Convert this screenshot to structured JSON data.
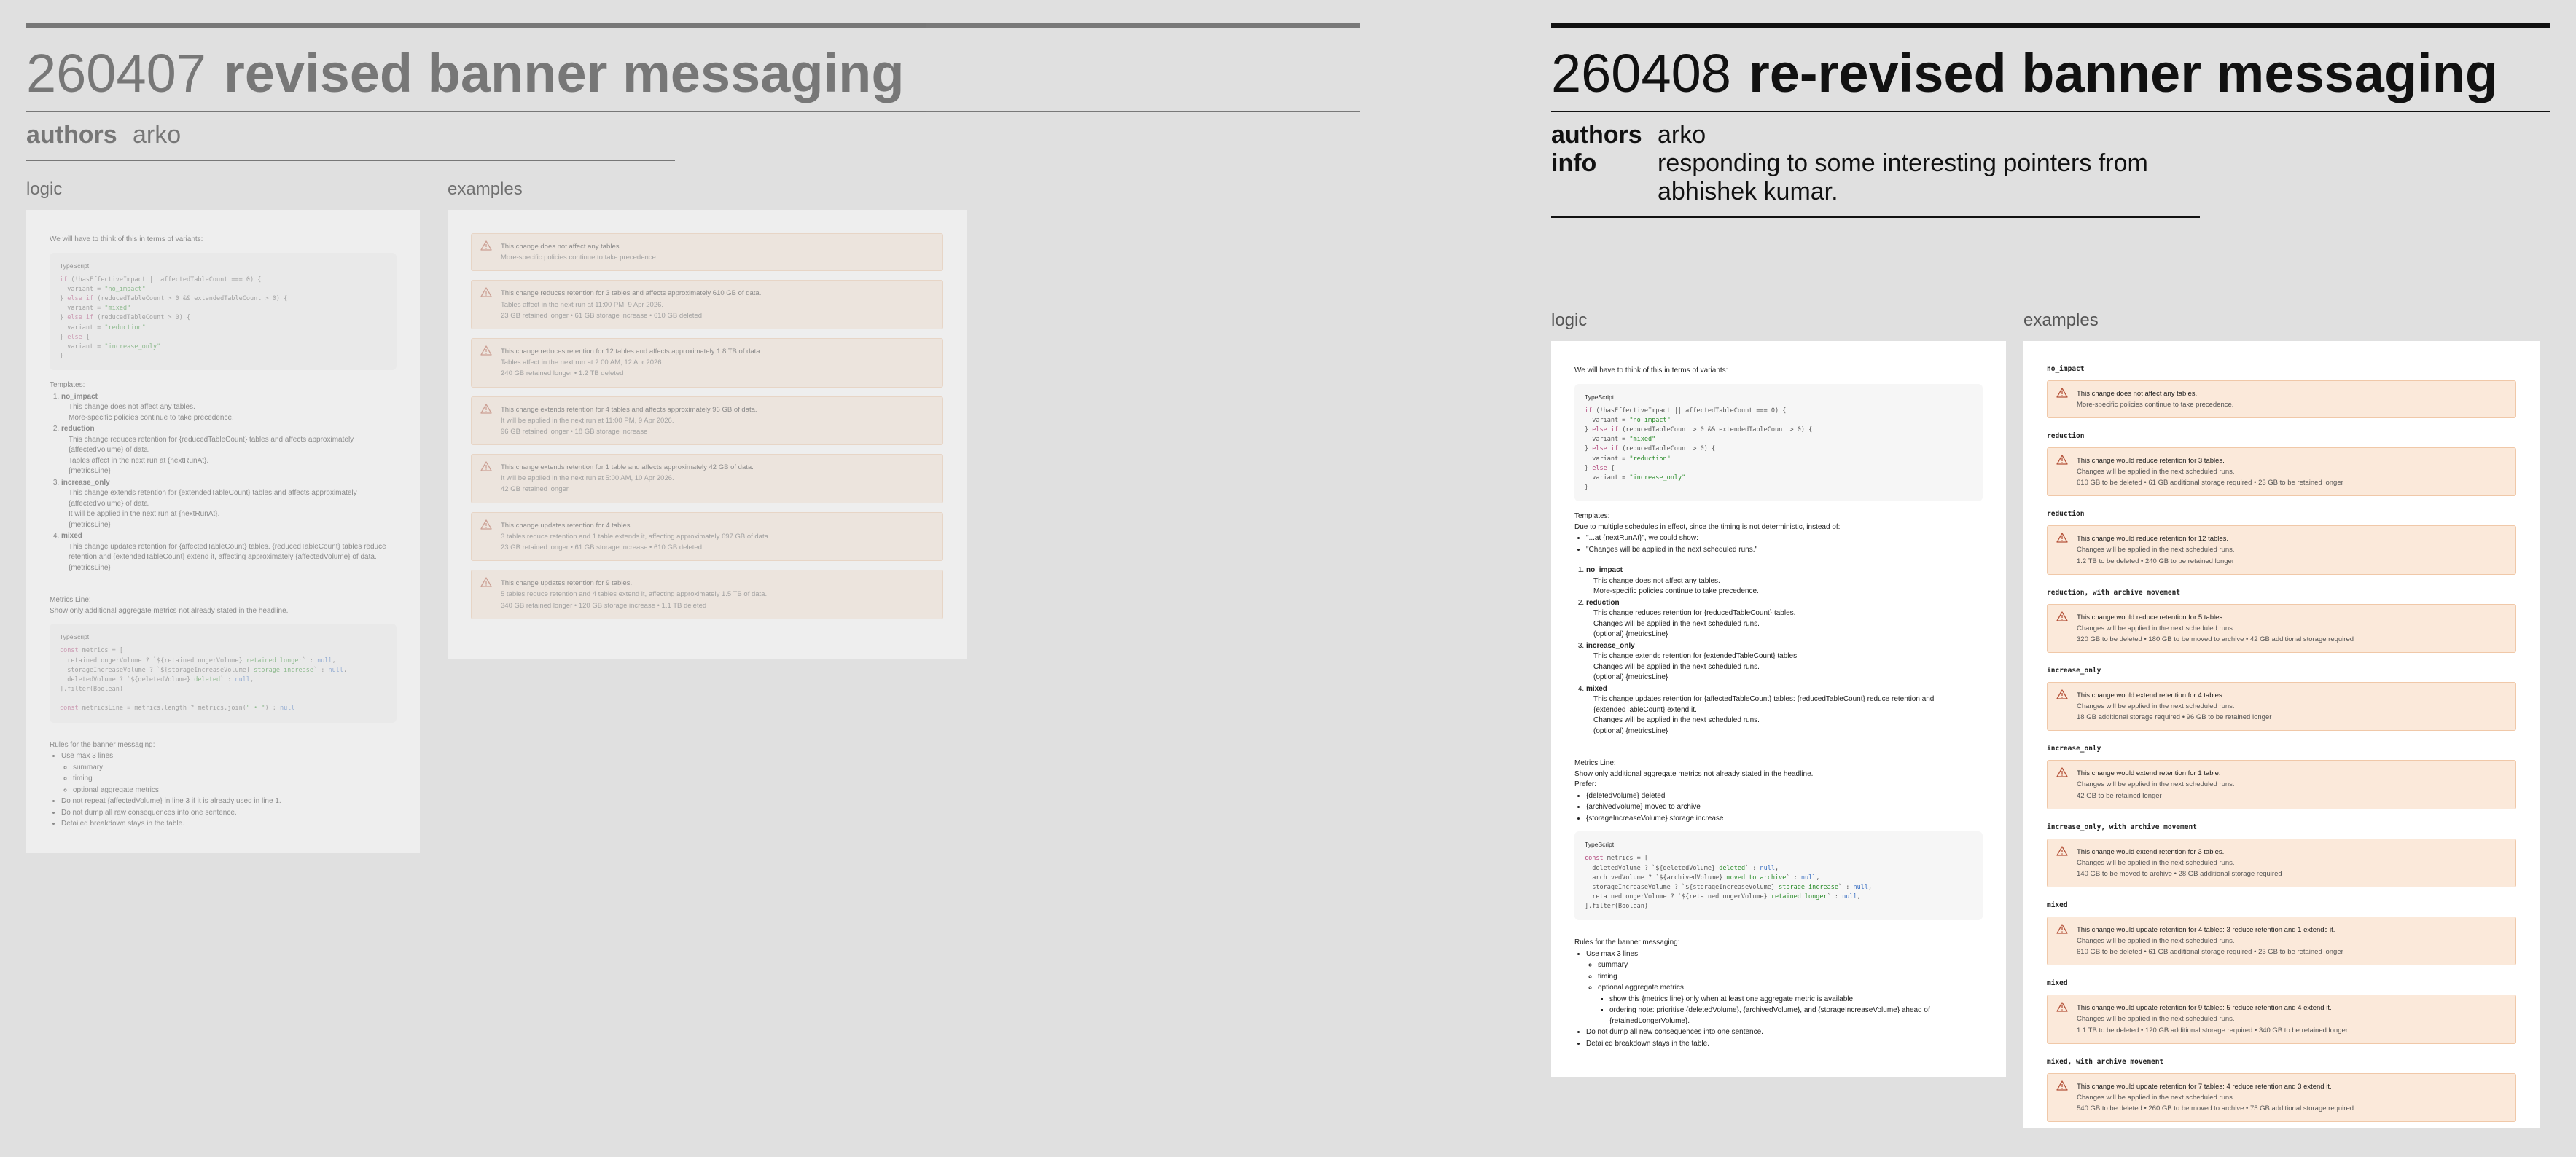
{
  "left": {
    "number": "260407",
    "name": "revised banner messaging",
    "meta": [
      {
        "k": "authors",
        "v": "arko"
      }
    ],
    "logic_label": "logic",
    "examples_label": "examples",
    "intro": "We will have to think of this in terms of variants:",
    "code_lang": "TypeScript",
    "templates_label": "Templates:",
    "templates": [
      {
        "name": "no_impact",
        "lines": [
          "This change does not affect any tables.",
          "More-specific policies continue to take precedence."
        ]
      },
      {
        "name": "reduction",
        "lines": [
          "This change reduces retention for {reducedTableCount} tables and affects approximately {affectedVolume} of data.",
          "Tables affect in the next run at {nextRunAt}.",
          "{metricsLine}"
        ]
      },
      {
        "name": "increase_only",
        "lines": [
          "This change extends retention for {extendedTableCount} tables and affects approximately {affectedVolume} of data.",
          "It will be applied in the next run at {nextRunAt}.",
          "{metricsLine}"
        ]
      },
      {
        "name": "mixed",
        "lines": [
          "This change updates retention for {affectedTableCount} tables. {reducedTableCount} tables reduce retention and {extendedTableCount} extend it, affecting approximately {affectedVolume} of data.",
          "{metricsLine}"
        ]
      }
    ],
    "metrics_label": "Metrics Line:",
    "metrics_desc": "Show only additional aggregate metrics not already stated in the headline.",
    "rules_label": "Rules for the banner messaging:",
    "rules": [
      "Use max 3 lines:",
      "summary",
      "timing",
      "optional aggregate metrics",
      "Do not repeat {affectedVolume} in line 3 if it is already used in line 1.",
      "Do not dump all raw consequences into one sentence.",
      "Detailed breakdown stays in the table."
    ],
    "examples": [
      {
        "h": "This change does not affect any tables.",
        "s": [
          "More-specific policies continue to take precedence."
        ]
      },
      {
        "h": "This change reduces retention for 3 tables and affects approximately 610 GB of data.",
        "s": [
          "Tables affect in the next run at 11:00 PM, 9 Apr 2026.",
          "23 GB retained longer • 61 GB storage increase • 610 GB deleted"
        ]
      },
      {
        "h": "This change reduces retention for 12 tables and affects approximately 1.8 TB of data.",
        "s": [
          "Tables affect in the next run at 2:00 AM, 12 Apr 2026.",
          "240 GB retained longer • 1.2 TB deleted"
        ]
      },
      {
        "h": "This change extends retention for 4 tables and affects approximately 96 GB of data.",
        "s": [
          "It will be applied in the next run at 11:00 PM, 9 Apr 2026.",
          "96 GB retained longer • 18 GB storage increase"
        ]
      },
      {
        "h": "This change extends retention for 1 table and affects approximately 42 GB of data.",
        "s": [
          "It will be applied in the next run at 5:00 AM, 10 Apr 2026.",
          "42 GB retained longer"
        ]
      },
      {
        "h": "This change updates retention for 4 tables.",
        "s": [
          "3 tables reduce retention and 1 table extends it, affecting approximately 697 GB of data.",
          "23 GB retained longer • 61 GB storage increase • 610 GB deleted"
        ]
      },
      {
        "h": "This change updates retention for 9 tables.",
        "s": [
          "5 tables reduce retention and 4 tables extend it, affecting approximately 1.5 TB of data.",
          "340 GB retained longer • 120 GB storage increase • 1.1 TB deleted"
        ]
      }
    ]
  },
  "right": {
    "number": "260408",
    "name": "re-revised banner messaging",
    "meta": [
      {
        "k": "authors",
        "v": "arko"
      },
      {
        "k": "info",
        "v": "responding to some interesting pointers from abhishek kumar."
      }
    ],
    "logic_label": "logic",
    "examples_label": "examples",
    "intro": "We will have to think of this in terms of variants:",
    "code_lang": "TypeScript",
    "templates_label": "Templates:",
    "templates_intro": "Due to multiple schedules in effect, since the timing is not deterministic, instead of:",
    "templates_bullets": [
      "\"...at {nextRunAt}\", we could show:",
      "\"Changes will be applied in the next scheduled runs.\""
    ],
    "templates": [
      {
        "name": "no_impact",
        "lines": [
          "This change does not affect any tables.",
          "More-specific policies continue to take precedence."
        ]
      },
      {
        "name": "reduction",
        "lines": [
          "This change reduces retention for {reducedTableCount} tables.",
          "Changes will be applied in the next scheduled runs.",
          "(optional) {metricsLine}"
        ]
      },
      {
        "name": "increase_only",
        "lines": [
          "This change extends retention for {extendedTableCount} tables.",
          "Changes will be applied in the next scheduled runs.",
          "(optional) {metricsLine}"
        ]
      },
      {
        "name": "mixed",
        "lines": [
          "This change updates retention for {affectedTableCount} tables: {reducedTableCount} reduce retention and {extendedTableCount} extend it.",
          "Changes will be applied in the next scheduled runs.",
          "(optional) {metricsLine}"
        ]
      }
    ],
    "metrics_label": "Metrics Line:",
    "metrics_desc": "Show only additional aggregate metrics not already stated in the headline.",
    "prefer_label": "Prefer:",
    "prefer": [
      "{deletedVolume} deleted",
      "{archivedVolume} moved to archive",
      "{storageIncreaseVolume} storage increase"
    ],
    "rules_label": "Rules for the banner messaging:",
    "rules_top": "Use max 3 lines:",
    "rules_sub": [
      "summary",
      "timing",
      "optional aggregate metrics"
    ],
    "rules_sub2": [
      "show this {metrics line} only when at least one aggregate metric is available.",
      "ordering note: prioritise {deletedVolume}, {archivedVolume}, and {storageIncreaseVolume} ahead of {retainedLongerVolume}."
    ],
    "rules_tail": [
      "Do not dump all new consequences into one sentence.",
      "Detailed breakdown stays in the table."
    ],
    "examples": [
      {
        "label": "no_impact",
        "h": "This change does not affect any tables.",
        "s": [
          "More-specific policies continue to take precedence."
        ]
      },
      {
        "label": "reduction",
        "h": "This change would reduce retention for 3 tables.",
        "s": [
          "Changes will be applied in the next scheduled runs.",
          "610 GB to be deleted • 61 GB additional storage required • 23 GB to be retained longer"
        ]
      },
      {
        "label": "reduction",
        "h": "This change would reduce retention for 12 tables.",
        "s": [
          "Changes will be applied in the next scheduled runs.",
          "1.2 TB to be deleted • 240 GB to be retained longer"
        ]
      },
      {
        "label": "reduction, with archive movement",
        "h": "This change would reduce retention for 5 tables.",
        "s": [
          "Changes will be applied in the next scheduled runs.",
          "320 GB to be deleted • 180 GB to be moved to archive • 42 GB additional storage required"
        ]
      },
      {
        "label": "increase_only",
        "h": "This change would extend retention for 4 tables.",
        "s": [
          "Changes will be applied in the next scheduled runs.",
          "18 GB additional storage required • 96 GB to be retained longer"
        ]
      },
      {
        "label": "increase_only",
        "h": "This change would extend retention for 1 table.",
        "s": [
          "Changes will be applied in the next scheduled runs.",
          "42 GB to be retained longer"
        ]
      },
      {
        "label": "increase_only, with archive movement",
        "h": "This change would extend retention for 3 tables.",
        "s": [
          "Changes will be applied in the next scheduled runs.",
          "140 GB to be moved to archive • 28 GB additional storage required"
        ]
      },
      {
        "label": "mixed",
        "h": "This change would update retention for 4 tables: 3 reduce retention and 1 extends it.",
        "s": [
          "Changes will be applied in the next scheduled runs.",
          "610 GB to be deleted • 61 GB additional storage required • 23 GB to be retained longer"
        ]
      },
      {
        "label": "mixed",
        "h": "This change would update retention for 9 tables: 5 reduce retention and 4 extend it.",
        "s": [
          "Changes will be applied in the next scheduled runs.",
          "1.1 TB to be deleted • 120 GB additional storage required • 340 GB to be retained longer"
        ]
      },
      {
        "label": "mixed, with archive movement",
        "h": "This change would update retention for 7 tables: 4 reduce retention and 3 extend it.",
        "s": [
          "Changes will be applied in the next scheduled runs.",
          "540 GB to be deleted • 260 GB to be moved to archive • 75 GB additional storage required"
        ]
      }
    ]
  }
}
